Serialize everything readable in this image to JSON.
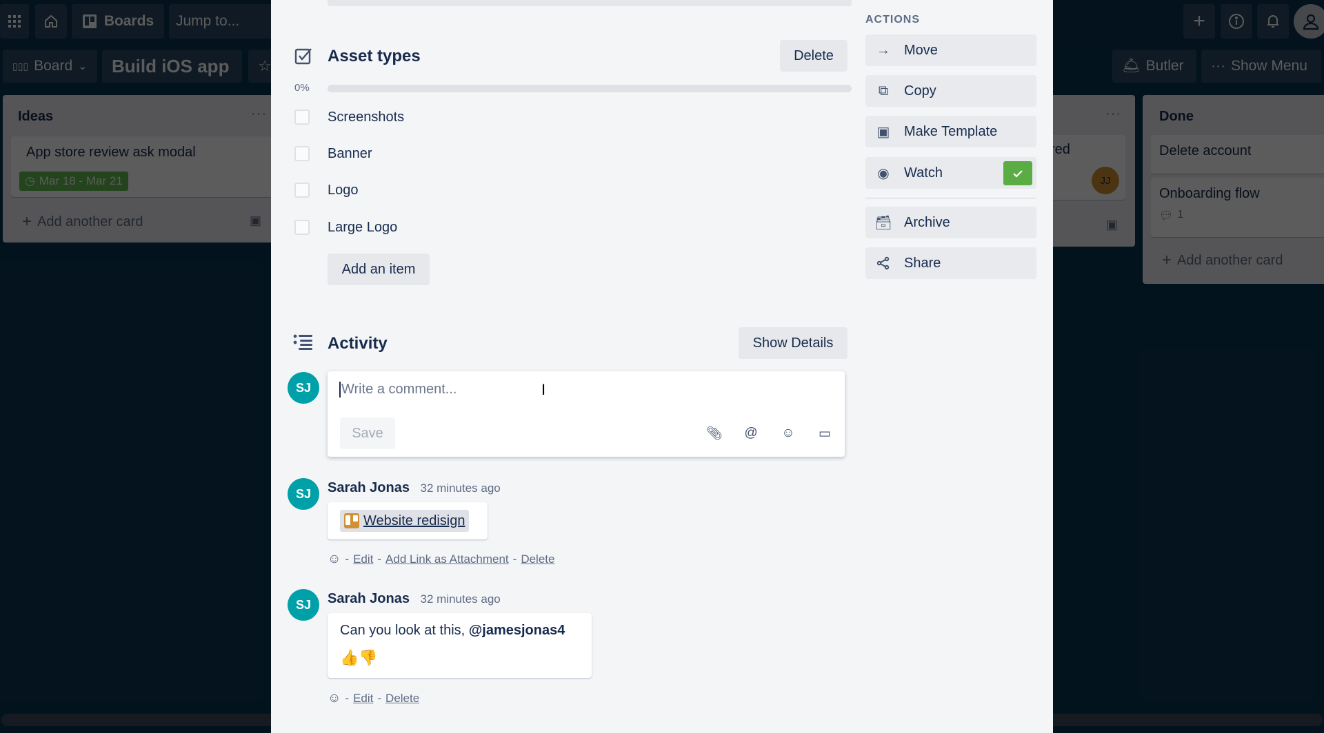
{
  "topbar": {
    "apps_icon": "grid-icon",
    "home_icon": "home-icon",
    "boards_label": "Boards",
    "jump_placeholder": "Jump to...",
    "create_icon": "plus-icon",
    "info_icon": "info-icon",
    "notifications_icon": "bell-icon",
    "account_icon": "user-icon"
  },
  "board_header": {
    "view_label": "Board",
    "board_name": "Build iOS app",
    "butler_label": "Butler",
    "show_menu_label": "Show Menu"
  },
  "lists": [
    {
      "title": "Ideas",
      "cards": [
        {
          "title": "App store review ask modal",
          "due": "Mar 18 - Mar 21"
        }
      ],
      "add_card_label": "Add another card"
    },
    {
      "title_partial": "",
      "cards": [
        {
          "title_partial": "red",
          "member_initials": "JJ"
        }
      ]
    },
    {
      "title": "Done",
      "cards": [
        {
          "title": "Delete account"
        },
        {
          "title": "Onboarding flow",
          "comments": "1"
        }
      ],
      "add_card_label": "Add another card"
    }
  ],
  "modal": {
    "checklist": {
      "title": "Asset types",
      "delete_label": "Delete",
      "progress_label": "0%",
      "progress_percent": 0,
      "items": [
        {
          "text": "Screenshots",
          "checked": false
        },
        {
          "text": "Banner",
          "checked": false
        },
        {
          "text": "Logo",
          "checked": false
        },
        {
          "text": "Large Logo",
          "checked": false
        }
      ],
      "add_item_label": "Add an item"
    },
    "activity": {
      "title": "Activity",
      "show_details_label": "Show Details",
      "comment_placeholder": "Write a comment...",
      "save_label": "Save",
      "current_user_initials": "SJ",
      "comments": [
        {
          "initials": "SJ",
          "author": "Sarah Jonas",
          "time": "32 minutes ago",
          "link_text": "Website redisign",
          "actions": [
            "Edit",
            "Add Link as Attachment",
            "Delete"
          ]
        },
        {
          "initials": "SJ",
          "author": "Sarah Jonas",
          "time": "32 minutes ago",
          "text": "Can you look at this, ",
          "mention": "@jamesjonas4",
          "emojis": "👍👎",
          "actions": [
            "Edit",
            "Delete"
          ]
        }
      ]
    },
    "actions": {
      "heading": "ACTIONS",
      "items": [
        {
          "label": "Move",
          "icon": "arrow-right-icon"
        },
        {
          "label": "Copy",
          "icon": "copy-icon"
        },
        {
          "label": "Make Template",
          "icon": "template-icon"
        },
        {
          "label": "Watch",
          "icon": "eye-icon",
          "active": true
        },
        {
          "label": "Archive",
          "icon": "archive-icon"
        },
        {
          "label": "Share",
          "icon": "share-icon"
        }
      ],
      "watch_check_color": "#5aac44"
    }
  }
}
